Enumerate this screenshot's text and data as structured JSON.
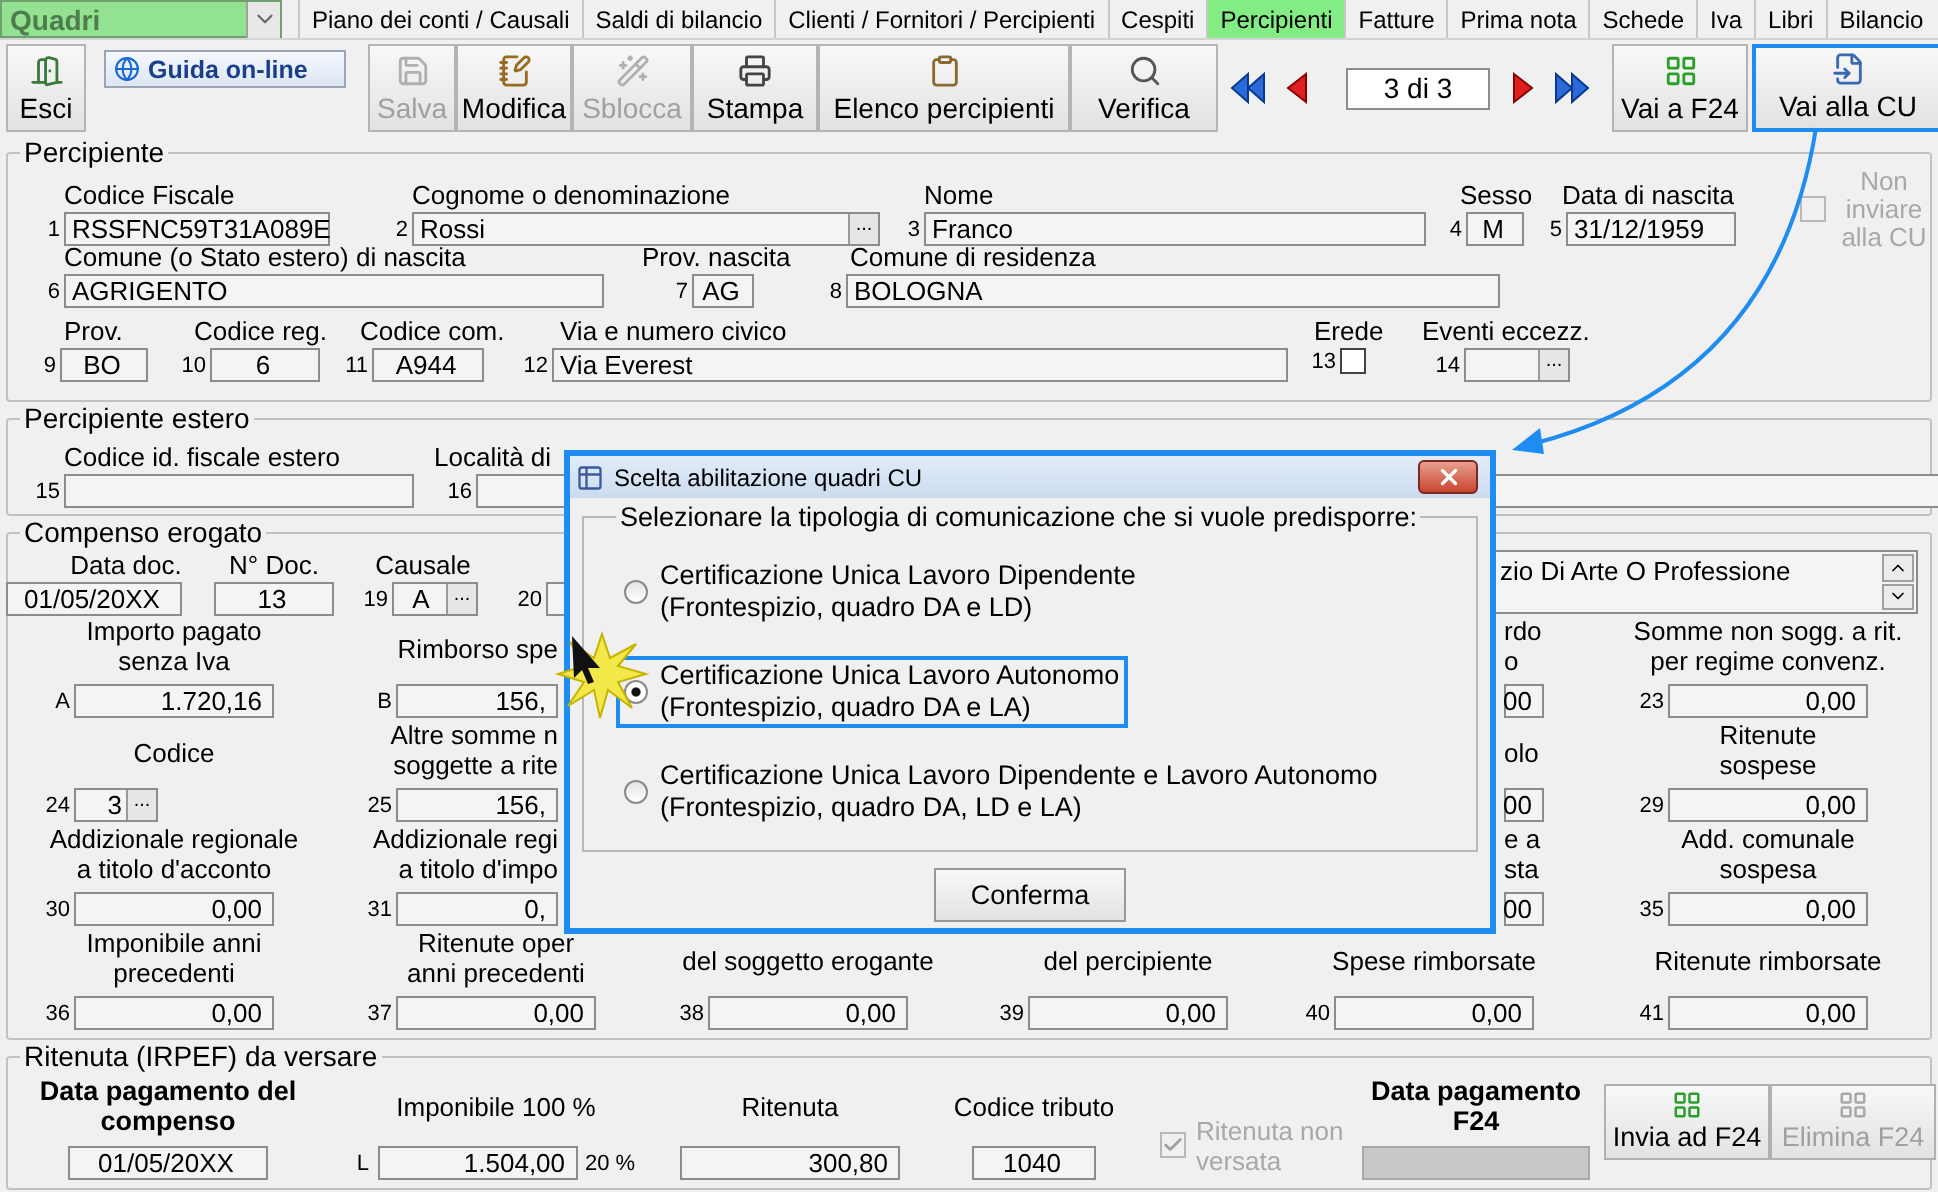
{
  "module_select": {
    "value": "Quadri"
  },
  "nav_tabs": [
    {
      "label": "Piano dei conti / Causali",
      "selected": false
    },
    {
      "label": "Saldi di bilancio",
      "selected": false
    },
    {
      "label": "Clienti / Fornitori / Percipienti",
      "selected": false
    },
    {
      "label": "Cespiti",
      "selected": false
    },
    {
      "label": "Percipienti",
      "selected": true
    },
    {
      "label": "Fatture",
      "selected": false
    },
    {
      "label": "Prima nota",
      "selected": false
    },
    {
      "label": "Schede",
      "selected": false
    },
    {
      "label": "Iva",
      "selected": false
    },
    {
      "label": "Libri",
      "selected": false
    },
    {
      "label": "Bilancio",
      "selected": false
    }
  ],
  "toolbar": {
    "exit_button": "Esci",
    "help_link": "Guida on-line",
    "actions": [
      {
        "label": "Salva",
        "disabled": true
      },
      {
        "label": "Modifica",
        "disabled": false
      },
      {
        "label": "Sblocca",
        "disabled": true
      },
      {
        "label": "Stampa",
        "disabled": false
      },
      {
        "label": "Elenco percipienti",
        "disabled": false
      },
      {
        "label": "Verifica",
        "disabled": false
      }
    ],
    "record_position": "3 di 3",
    "goto_buttons": [
      {
        "label": "Vai a F24",
        "highlighted": false
      },
      {
        "label": "Vai alla CU",
        "highlighted": true
      }
    ]
  },
  "percipiente": {
    "title": "Percipiente",
    "lines": [
      {
        "fields": [
          {
            "kind": "text",
            "number": "1",
            "label": "Codice Fiscale",
            "value": "RSSFNC59T31A089E"
          },
          {
            "kind": "text",
            "number": "2",
            "label": "Cognome o denominazione",
            "value": "Rossi",
            "lookup_button": "..."
          },
          {
            "kind": "text",
            "number": "3",
            "label": "Nome",
            "value": "Franco"
          },
          {
            "kind": "text",
            "number": "4",
            "label": "Sesso",
            "value": "M"
          },
          {
            "kind": "text",
            "number": "5",
            "label": "Data di nascita",
            "value": "31/12/1959"
          }
        ]
      },
      {
        "fields": [
          {
            "kind": "text",
            "number": "6",
            "label": "Comune (o Stato estero) di nascita",
            "value": "AGRIGENTO"
          },
          {
            "kind": "text",
            "number": "7",
            "label": "Prov. nascita",
            "value": "AG"
          },
          {
            "kind": "text",
            "number": "8",
            "label": "Comune di residenza",
            "value": "BOLOGNA"
          }
        ]
      },
      {
        "fields": [
          {
            "kind": "text",
            "number": "9",
            "label": "Prov.",
            "value": "BO"
          },
          {
            "kind": "text",
            "number": "10",
            "label": "Codice reg.",
            "value": "6"
          },
          {
            "kind": "text",
            "number": "11",
            "label": "Codice com.",
            "value": "A944"
          },
          {
            "kind": "text",
            "number": "12",
            "label": "Via e numero civico",
            "value": "Via Everest"
          },
          {
            "kind": "checkbox",
            "number": "13",
            "label": "Erede",
            "checked": false
          },
          {
            "kind": "text",
            "number": "14",
            "label": "Eventi eccezz.",
            "lookup_button": "..."
          }
        ]
      }
    ],
    "no_send": {
      "label": "Non inviare alla CU",
      "checked": false,
      "disabled": true
    }
  },
  "percipiente_estero": {
    "title": "Percipiente estero",
    "fields": [
      {
        "number": "15",
        "label": "Codice id. fiscale estero"
      },
      {
        "number": "16",
        "label": "Località di"
      }
    ]
  },
  "compenso": {
    "title": "Compenso erogato",
    "doc_fields": [
      {
        "label": "Data doc.",
        "value": "01/05/20XX"
      },
      {
        "label": "N° Doc.",
        "value": "13"
      },
      {
        "number": "19",
        "label": "Causale",
        "value": "A",
        "lookup_button": "..."
      },
      {
        "number": "20"
      }
    ],
    "causale_description": "zio Di Arte O Professione",
    "amount_rows": [
      {
        "column_1": {
          "number": "A",
          "label": [
            "Importo pagato",
            "senza Iva"
          ],
          "value": "1.720,16"
        },
        "column_2": {
          "number": "B",
          "label": [
            "Rimborso spe"
          ],
          "value": "156,"
        },
        "column_5": {
          "label": [
            "rdo",
            "o"
          ],
          "value": "00"
        },
        "column_6": {
          "number": "23",
          "label": [
            "Somme non sogg. a rit.",
            "per regime convenz."
          ],
          "value": "0,00"
        }
      },
      {
        "column_1": {
          "number": "24",
          "label": [
            "Codice"
          ],
          "value": "3",
          "lookup_button": "..."
        },
        "column_2": {
          "number": "25",
          "label": [
            "Altre somme n",
            "soggette a rite"
          ],
          "value": "156,"
        },
        "column_5": {
          "label": [
            "olo"
          ],
          "value": "00"
        },
        "column_6": {
          "number": "29",
          "label": [
            "Ritenute",
            "sospese"
          ],
          "value": "0,00"
        }
      },
      {
        "column_1": {
          "number": "30",
          "label": [
            "Addizionale regionale",
            "a titolo d'acconto"
          ],
          "value": "0,00"
        },
        "column_2": {
          "number": "31",
          "label": [
            "Addizionale regi",
            "a titolo d'impo"
          ],
          "value": "0,"
        },
        "column_5": {
          "label": [
            "e a",
            "sta"
          ],
          "value": "00"
        },
        "column_6": {
          "number": "35",
          "label": [
            "Add. comunale",
            "sospesa"
          ],
          "value": "0,00"
        }
      },
      {
        "column_1": {
          "number": "36",
          "label": [
            "Imponibile anni",
            "precedenti"
          ],
          "value": "0,00"
        },
        "column_2": {
          "number": "37",
          "label": [
            "Ritenute oper",
            "anni precedenti"
          ],
          "value": "0,00"
        },
        "column_3": {
          "number": "38",
          "label": [
            "del soggetto erogante"
          ],
          "value": "0,00"
        },
        "column_4": {
          "number": "39",
          "label": [
            "del percipiente"
          ],
          "value": "0,00"
        },
        "column_5": {
          "number": "40",
          "label": [
            "Spese rimborsate"
          ],
          "value": "0,00"
        },
        "column_6": {
          "number": "41",
          "label": [
            "Ritenute rimborsate"
          ],
          "value": "0,00"
        }
      }
    ]
  },
  "ritenuta": {
    "title": "Ritenuta (IRPEF) da versare",
    "payment_date": {
      "label": "Data pagamento del compenso",
      "value": "01/05/20XX"
    },
    "taxable": {
      "label": "Imponibile 100 %",
      "number": "L",
      "value": "1.504,00",
      "rate": "20 %"
    },
    "withholding": {
      "label": "Ritenuta",
      "value": "300,80"
    },
    "tax_code": {
      "label": "Codice tributo",
      "value": "1040"
    },
    "not_paid": {
      "label": "Ritenuta non versata",
      "checked": true,
      "disabled": true
    },
    "f24_date": {
      "label": "Data pagamento F24",
      "disabled": true
    },
    "buttons": [
      {
        "label": "Invia ad F24",
        "disabled": false
      },
      {
        "label": "Elimina F24",
        "disabled": true
      }
    ]
  },
  "dialog": {
    "title": "Scelta abilitazione quadri CU",
    "prompt": "Selezionare la tipologia di comunicazione che si vuole predisporre:",
    "options": [
      {
        "label": "Certificazione Unica Lavoro Dipendente",
        "detail": "(Frontespizio, quadro DA e LD)",
        "selected": false,
        "highlighted": false
      },
      {
        "label": "Certificazione Unica Lavoro Autonomo",
        "detail": "(Frontespizio, quadro DA e LA)",
        "selected": true,
        "highlighted": true
      },
      {
        "label": "Certificazione Unica Lavoro Dipendente e Lavoro Autonomo",
        "detail": "(Frontespizio, quadro DA, LD e LA)",
        "selected": false,
        "highlighted": false
      }
    ],
    "confirm_button": "Conferma"
  }
}
